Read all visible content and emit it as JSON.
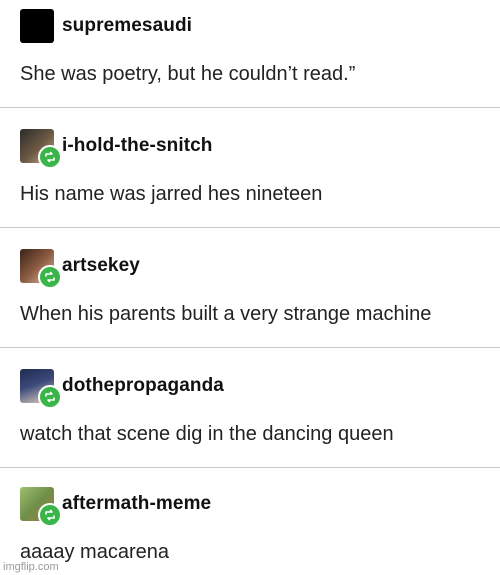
{
  "posts": [
    {
      "username": "supremesaudi",
      "text": "She was poetry, but he couldn’t read.”",
      "reblog": false,
      "avatar_color": "#000000"
    },
    {
      "username": "i-hold-the-snitch",
      "text": "His name was jarred hes nineteen",
      "reblog": true,
      "avatar_color": "#5a4a3a"
    },
    {
      "username": "artsekey",
      "text": "When his parents built a very strange machine",
      "reblog": true,
      "avatar_color": "#6b3a2a"
    },
    {
      "username": "dothepropaganda",
      "text": "watch that scene dig in the dancing queen",
      "reblog": true,
      "avatar_color": "#2f3b63"
    },
    {
      "username": "aftermath-meme",
      "text": "aaaay macarena",
      "reblog": true,
      "avatar_color": "#7fa35a"
    }
  ],
  "watermark": "imgflip.com",
  "colors": {
    "reblog_badge": "#3ab54a",
    "divider": "#c9c9c9"
  },
  "icons": {
    "reblog": "reblog-icon"
  }
}
